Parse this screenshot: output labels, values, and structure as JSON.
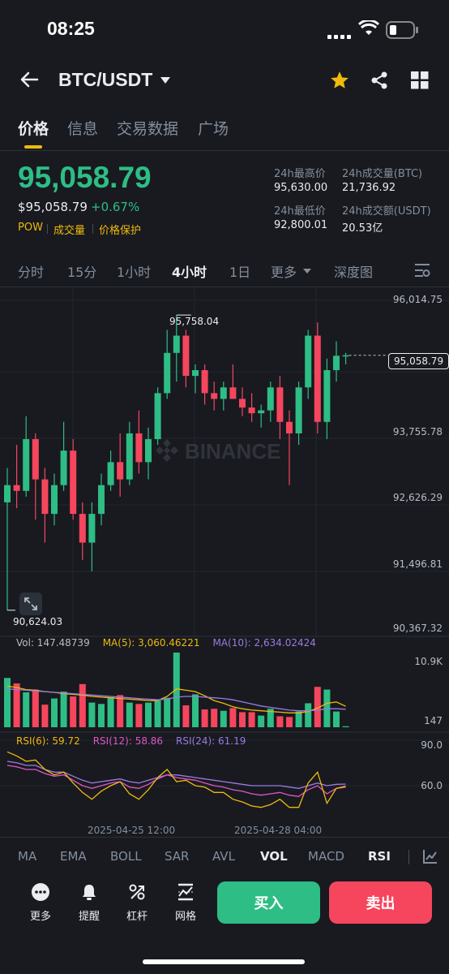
{
  "status": {
    "time": "08:25"
  },
  "header": {
    "pair": "BTC/USDT"
  },
  "tabs": [
    "价格",
    "信息",
    "交易数据",
    "广场"
  ],
  "price": {
    "last": "95,058.79",
    "usd": "$95,058.79",
    "change": "+0.67%",
    "tags": [
      "POW",
      "成交量",
      "价格保护"
    ]
  },
  "stats": {
    "high_label": "24h最高价",
    "high": "95,630.00",
    "vol_btc_label": "24h成交量(BTC)",
    "vol_btc": "21,736.92",
    "low_label": "24h最低价",
    "low": "92,800.01",
    "vol_usdt_label": "24h成交额(USDT)",
    "vol_usdt": "20.53亿"
  },
  "timeframes": [
    "分时",
    "15分",
    "1小时",
    "4小时",
    "1日",
    "更多",
    "深度图"
  ],
  "chart": {
    "y_labels": [
      "96,014.75",
      "93,755.78",
      "92,626.29",
      "91,496.81",
      "90,367.32"
    ],
    "current_price_tag": "95,058.79",
    "high_marker": "95,758.04",
    "low_marker": "90,624.03",
    "watermark": "BINANCE",
    "vol_legend": {
      "vol": "Vol: 147.48739",
      "ma5": "MA(5): 3,060.46221",
      "ma10": "MA(10): 2,634.02424"
    },
    "vol_axis": [
      "10.9K",
      "147"
    ],
    "rsi_legend": {
      "rsi6": "RSI(6): 59.72",
      "rsi12": "RSI(12): 58.86",
      "rsi24": "RSI(24): 61.19"
    },
    "rsi_axis": [
      "90.0",
      "60.0"
    ],
    "x_labels": [
      "2025-04-25 12:00",
      "2025-04-28 04:00"
    ]
  },
  "chart_data": {
    "type": "candlestick",
    "y_range": [
      90367.32,
      96014.75
    ],
    "candles": [
      {
        "o": 92500,
        "h": 93100,
        "l": 90624.03,
        "c": 92800
      },
      {
        "o": 92800,
        "h": 93500,
        "l": 92400,
        "c": 92700
      },
      {
        "o": 92700,
        "h": 94000,
        "l": 92600,
        "c": 93600
      },
      {
        "o": 93600,
        "h": 93700,
        "l": 92200,
        "c": 92900
      },
      {
        "o": 92900,
        "h": 93100,
        "l": 91800,
        "c": 92300
      },
      {
        "o": 92300,
        "h": 93000,
        "l": 92100,
        "c": 92800
      },
      {
        "o": 92800,
        "h": 93900,
        "l": 92700,
        "c": 93400
      },
      {
        "o": 93400,
        "h": 93600,
        "l": 92200,
        "c": 92300
      },
      {
        "o": 92300,
        "h": 92500,
        "l": 91500,
        "c": 91800
      },
      {
        "o": 91800,
        "h": 92500,
        "l": 91300,
        "c": 92300
      },
      {
        "o": 92300,
        "h": 93000,
        "l": 92100,
        "c": 92800
      },
      {
        "o": 92800,
        "h": 93400,
        "l": 92700,
        "c": 93200
      },
      {
        "o": 93200,
        "h": 93700,
        "l": 92600,
        "c": 92900
      },
      {
        "o": 92900,
        "h": 93900,
        "l": 92800,
        "c": 93700
      },
      {
        "o": 93700,
        "h": 94100,
        "l": 93000,
        "c": 93200
      },
      {
        "o": 93200,
        "h": 93800,
        "l": 92900,
        "c": 93600
      },
      {
        "o": 93600,
        "h": 94500,
        "l": 93500,
        "c": 94400
      },
      {
        "o": 94400,
        "h": 95500,
        "l": 94300,
        "c": 95100
      },
      {
        "o": 95100,
        "h": 95758.04,
        "l": 94600,
        "c": 95400
      },
      {
        "o": 95400,
        "h": 95500,
        "l": 94500,
        "c": 94700
      },
      {
        "o": 94700,
        "h": 94900,
        "l": 94400,
        "c": 94800
      },
      {
        "o": 94800,
        "h": 94900,
        "l": 94200,
        "c": 94400
      },
      {
        "o": 94400,
        "h": 94600,
        "l": 94100,
        "c": 94300
      },
      {
        "o": 94300,
        "h": 94600,
        "l": 94100,
        "c": 94500
      },
      {
        "o": 94500,
        "h": 94900,
        "l": 94300,
        "c": 94300
      },
      {
        "o": 94300,
        "h": 94500,
        "l": 94000,
        "c": 94150
      },
      {
        "o": 94150,
        "h": 94400,
        "l": 93900,
        "c": 94050
      },
      {
        "o": 94050,
        "h": 94200,
        "l": 93800,
        "c": 94100
      },
      {
        "o": 94100,
        "h": 94600,
        "l": 93900,
        "c": 94500
      },
      {
        "o": 94500,
        "h": 94700,
        "l": 93600,
        "c": 93900
      },
      {
        "o": 93900,
        "h": 94100,
        "l": 92800,
        "c": 93700
      },
      {
        "o": 93700,
        "h": 94600,
        "l": 93500,
        "c": 94500
      },
      {
        "o": 94500,
        "h": 95500,
        "l": 94300,
        "c": 95400
      },
      {
        "o": 95400,
        "h": 95630,
        "l": 93700,
        "c": 93900
      },
      {
        "o": 93900,
        "h": 95000,
        "l": 93600,
        "c": 94800
      },
      {
        "o": 94800,
        "h": 95300,
        "l": 94600,
        "c": 95050
      },
      {
        "o": 95050,
        "h": 95100,
        "l": 94900,
        "c": 95058.79
      }
    ],
    "volume_range": [
      147,
      10900
    ],
    "volumes": [
      7200,
      6400,
      5100,
      5500,
      3300,
      4200,
      5200,
      4500,
      6300,
      3600,
      3400,
      4400,
      4700,
      3600,
      3400,
      3600,
      3900,
      4300,
      10900,
      3200,
      4800,
      2600,
      2700,
      2400,
      2800,
      2200,
      2200,
      1700,
      2700,
      1600,
      1500,
      2300,
      3500,
      5900,
      5500,
      2300,
      147
    ],
    "ma5": [
      6000,
      5800,
      5500,
      5400,
      5200,
      5100,
      4900,
      4800,
      4700,
      4500,
      4400,
      4300,
      4200,
      4100,
      4000,
      3900,
      3900,
      4500,
      5600,
      5400,
      5200,
      4600,
      3900,
      3500,
      3000,
      2700,
      2500,
      2400,
      2300,
      2200,
      2100,
      2100,
      2300,
      2800,
      3500,
      3700,
      3060
    ],
    "ma10": [
      5600,
      5500,
      5400,
      5300,
      5200,
      5100,
      5000,
      4900,
      4800,
      4700,
      4600,
      4500,
      4400,
      4300,
      4200,
      4100,
      4000,
      4100,
      4400,
      4500,
      4500,
      4400,
      4300,
      4200,
      4000,
      3700,
      3400,
      3100,
      2900,
      2700,
      2500,
      2400,
      2400,
      2500,
      2700,
      2700,
      2634
    ],
    "rsi_axis_values": [
      90.0,
      60.0
    ],
    "rsi6": [
      85,
      82,
      78,
      79,
      72,
      68,
      70,
      62,
      55,
      50,
      56,
      60,
      63,
      54,
      50,
      57,
      66,
      72,
      63,
      64,
      60,
      59,
      55,
      55,
      50,
      48,
      45,
      44,
      46,
      50,
      44,
      44,
      62,
      70,
      47,
      58,
      59.72
    ],
    "rsi12": [
      75,
      74,
      72,
      72,
      69,
      67,
      68,
      64,
      60,
      58,
      60,
      62,
      63,
      59,
      58,
      61,
      65,
      68,
      66,
      65,
      64,
      62,
      60,
      59,
      57,
      56,
      54,
      53,
      54,
      55,
      53,
      52,
      57,
      60,
      54,
      58,
      58.86
    ],
    "rsi24": [
      78,
      77,
      75,
      75,
      72,
      70,
      70,
      67,
      64,
      62,
      63,
      64,
      65,
      63,
      62,
      64,
      66,
      68,
      68,
      67,
      66,
      65,
      64,
      63,
      62,
      61,
      60,
      60,
      60,
      60,
      59,
      58,
      60,
      62,
      60,
      61,
      61.19
    ]
  },
  "indicators": [
    "MA",
    "EMA",
    "BOLL",
    "SAR",
    "AVL",
    "VOL",
    "MACD",
    "RSI"
  ],
  "actions": [
    "更多",
    "提醒",
    "杠杆",
    "网格"
  ],
  "buttons": {
    "buy": "买入",
    "sell": "卖出"
  }
}
